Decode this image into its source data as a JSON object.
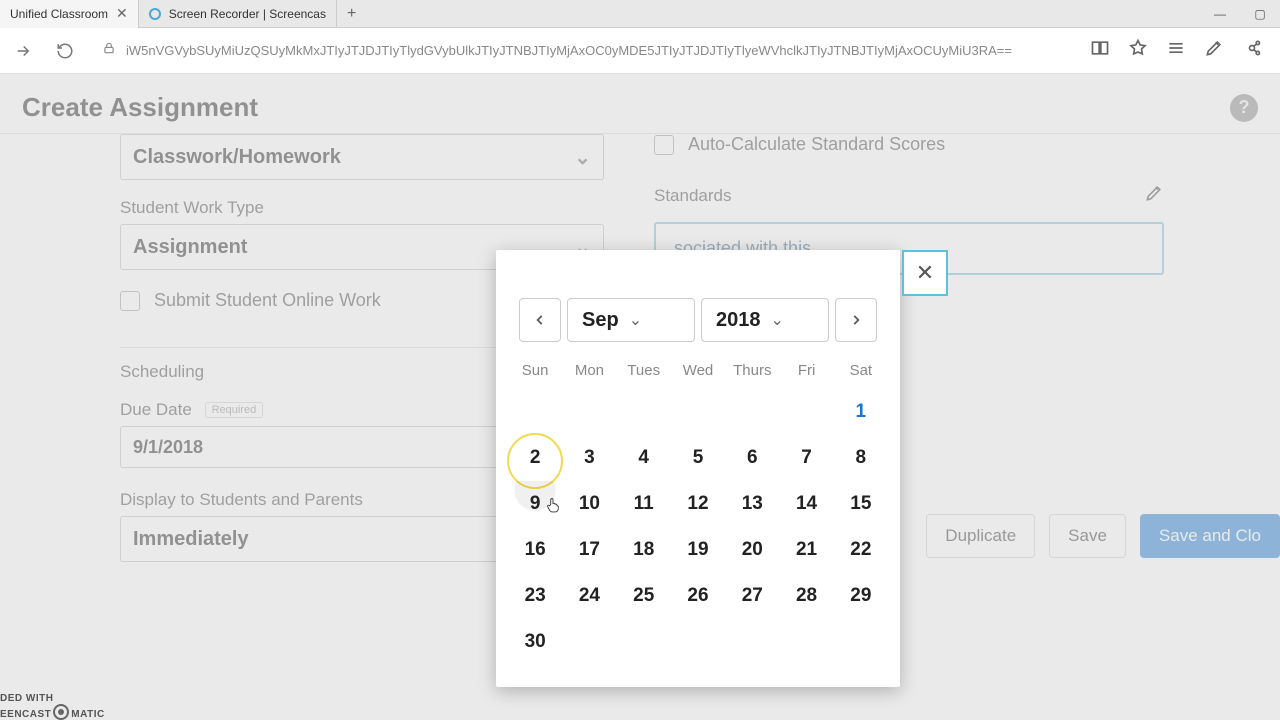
{
  "browser": {
    "tabs": [
      {
        "title": "Unified Classroom"
      },
      {
        "title": "Screen Recorder | Screencas"
      }
    ],
    "url": "iW5nVGVybSUyMiUzQSUyMkMxJTIyJTJDJTIyTlydGVybUlkJTIyJTNBJTIyMjAxOC0yMDE5JTIyJTJDJTIyTlyeWVhclkJTIyJTNBJTIyMjAxOCUyMiU3RA=="
  },
  "page": {
    "title": "Create Assignment",
    "help_tooltip": "?",
    "fields": {
      "category_label": "",
      "category_value": "Classwork/Homework",
      "work_type_label": "Student Work Type",
      "work_type_value": "Assignment",
      "submit_online_label": "Submit Student Online Work",
      "scheduling_section": "Scheduling",
      "due_date_label": "Due Date",
      "required_badge": "Required",
      "due_date_value": "9/1/2018",
      "display_label": "Display to Students and Parents",
      "display_value": "Immediately",
      "auto_calc_label": "Auto-Calculate Standard Scores",
      "standards_label": "Standards",
      "standards_box_text": "sociated with this"
    },
    "buttons": {
      "duplicate": "Duplicate",
      "save": "Save",
      "save_close": "Save and Clo"
    }
  },
  "datepicker": {
    "month": "Sep",
    "year": "2018",
    "dow": [
      "Sun",
      "Mon",
      "Tues",
      "Wed",
      "Thurs",
      "Fri",
      "Sat"
    ],
    "weeks": [
      [
        "",
        "",
        "",
        "",
        "",
        "",
        "1"
      ],
      [
        "2",
        "3",
        "4",
        "5",
        "6",
        "7",
        "8"
      ],
      [
        "9",
        "10",
        "11",
        "12",
        "13",
        "14",
        "15"
      ],
      [
        "16",
        "17",
        "18",
        "19",
        "20",
        "21",
        "22"
      ],
      [
        "23",
        "24",
        "25",
        "26",
        "27",
        "28",
        "29"
      ],
      [
        "30",
        "",
        "",
        "",
        "",
        "",
        ""
      ]
    ],
    "selected_day": "1",
    "hover_day": "2"
  },
  "watermark": {
    "line1": "DED WITH",
    "line2_a": "EENCAST",
    "line2_b": "MATIC"
  }
}
